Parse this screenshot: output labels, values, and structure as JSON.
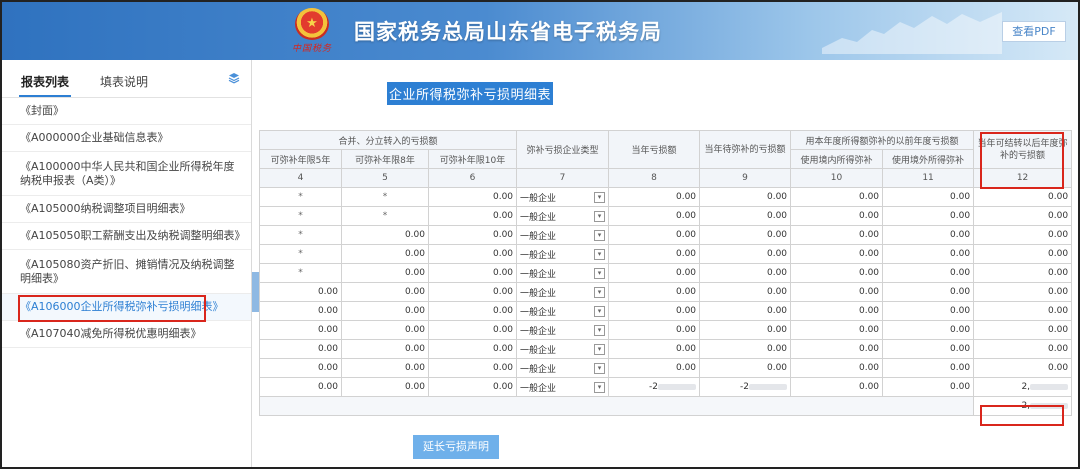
{
  "header": {
    "title": "国家税务总局山东省电子税务局",
    "emblem_text": "中国税务",
    "pdf_button": "查看PDF"
  },
  "sidebar": {
    "tabs": [
      "报表列表",
      "填表说明"
    ],
    "items": [
      "《封面》",
      "《A000000企业基础信息表》",
      "《A100000中华人民共和国企业所得税年度纳税申报表（A类）》",
      "《A105000纳税调整项目明细表》",
      "《A105050职工薪酬支出及纳税调整明细表》",
      "《A105080资产折旧、摊销情况及纳税调整明细表》",
      "《A106000企业所得税弥补亏损明细表》",
      "《A107040减免所得税优惠明细表》"
    ],
    "active_index": 6
  },
  "main": {
    "title": "企业所得税弥补亏损明细表",
    "headers": {
      "merge_group": "合并、分立转入的亏损额",
      "c4": "可弥补年限5年",
      "c5": "可弥补年限8年",
      "c6": "可弥补年限10年",
      "c7": "弥补亏损企业类型",
      "c8": "当年亏损额",
      "c9": "当年待弥补的亏损额",
      "used_group": "用本年度所得额弥补的以前年度亏损额",
      "c10": "使用境内所得弥补",
      "c11": "使用境外所得弥补",
      "c12": "当年可结转以后年度弥补的亏损额"
    },
    "col_numbers": [
      "4",
      "5",
      "6",
      "7",
      "8",
      "9",
      "10",
      "11",
      "12"
    ],
    "rows": [
      [
        "*",
        "*",
        "0.00",
        "一般企业",
        "0.00",
        "0.00",
        "0.00",
        "0.00",
        "0.00"
      ],
      [
        "*",
        "*",
        "0.00",
        "一般企业",
        "0.00",
        "0.00",
        "0.00",
        "0.00",
        "0.00"
      ],
      [
        "*",
        "0.00",
        "0.00",
        "一般企业",
        "0.00",
        "0.00",
        "0.00",
        "0.00",
        "0.00"
      ],
      [
        "*",
        "0.00",
        "0.00",
        "一般企业",
        "0.00",
        "0.00",
        "0.00",
        "0.00",
        "0.00"
      ],
      [
        "*",
        "0.00",
        "0.00",
        "一般企业",
        "0.00",
        "0.00",
        "0.00",
        "0.00",
        "0.00"
      ],
      [
        "0.00",
        "0.00",
        "0.00",
        "一般企业",
        "0.00",
        "0.00",
        "0.00",
        "0.00",
        "0.00"
      ],
      [
        "0.00",
        "0.00",
        "0.00",
        "一般企业",
        "0.00",
        "0.00",
        "0.00",
        "0.00",
        "0.00"
      ],
      [
        "0.00",
        "0.00",
        "0.00",
        "一般企业",
        "0.00",
        "0.00",
        "0.00",
        "0.00",
        "0.00"
      ],
      [
        "0.00",
        "0.00",
        "0.00",
        "一般企业",
        "0.00",
        "0.00",
        "0.00",
        "0.00",
        "0.00"
      ],
      [
        "0.00",
        "0.00",
        "0.00",
        "一般企业",
        "0.00",
        "0.00",
        "0.00",
        "0.00",
        "0.00"
      ],
      [
        "0.00",
        "0.00",
        "0.00",
        "一般企业",
        "-2",
        "-2",
        "0.00",
        "0.00",
        "2,"
      ]
    ],
    "total_value": "2,",
    "extend_button": "延长亏损声明"
  },
  "colors": {
    "accent": "#2d7fd3",
    "highlight": "#d9261c"
  }
}
